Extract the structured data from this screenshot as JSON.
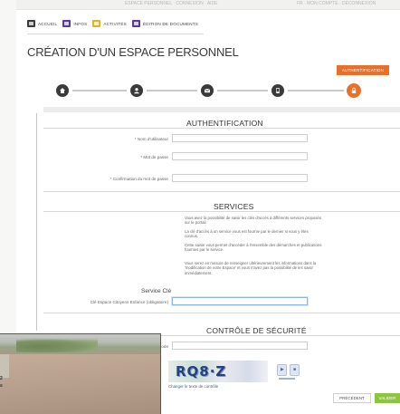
{
  "topbar": {
    "left_text": "ESPACE PERSONNEL · CONNEXION · AIDE",
    "right_text": "FR · MON COMPTE · DÉCONNEXION"
  },
  "nav": [
    {
      "label": "Accueil",
      "icon": "home-icon",
      "color": "#3b3b3b"
    },
    {
      "label": "Infos",
      "icon": "info-icon",
      "color": "#5b3d8f"
    },
    {
      "label": "Activités",
      "icon": "activities-icon",
      "color": "#d9b72c"
    },
    {
      "label": "Édition de documents",
      "icon": "documents-icon",
      "color": "#5b3d8f"
    }
  ],
  "page": {
    "title": "CRÉATION D'UN ESPACE PERSONNEL"
  },
  "steps": {
    "active_label": "AUTHENTIFICATION",
    "items": [
      {
        "icon": "home-icon"
      },
      {
        "icon": "user-icon"
      },
      {
        "icon": "envelope-icon"
      },
      {
        "icon": "phone-icon"
      },
      {
        "icon": "lock-icon",
        "active": true
      }
    ],
    "active_color": "#e8702a"
  },
  "auth": {
    "heading": "AUTHENTIFICATION",
    "fields": [
      {
        "label": "* Nom d'utilisateur",
        "value": ""
      },
      {
        "label": "* Mot de passe",
        "value": ""
      },
      {
        "label": "* Confirmation du mot de passe",
        "value": ""
      }
    ]
  },
  "services": {
    "heading": "SERVICES",
    "paragraphs": [
      "Vous avez la possibilité de saisir les clés d'accès à différents services proposés sur le portail.",
      "La clé d'accès à un service vous est fournie par le dernier si vous y êtes connus.",
      "Cette saisie vous permet d'accéder à l'ensemble des démarches et publications fournies par le service.",
      "Vous serez en mesure de renseigner ultérieurement les informations dans la 'modification de votre Espace' et vous n'avez pas la possibilité de les saisir immédiatement."
    ],
    "subheading": "Service Clé",
    "key_label": "Clé Espace Citoyens Enfance (obligatoire)",
    "key_value": ""
  },
  "security": {
    "heading": "CONTRÔLE DE SÉCURITÉ",
    "code_label": "Veuillez saisir le code",
    "captcha_text": "RQ8·Z",
    "change_link": "Changer le texte de contrôle"
  },
  "buttons": {
    "previous": "PRÉCÉDENT",
    "next": "VALIDER"
  },
  "photo": {
    "line1": "2",
    "line2": "s"
  },
  "colors": {
    "accent": "#e8702a",
    "valid": "#8cc63f",
    "link": "#3b5d8f"
  }
}
